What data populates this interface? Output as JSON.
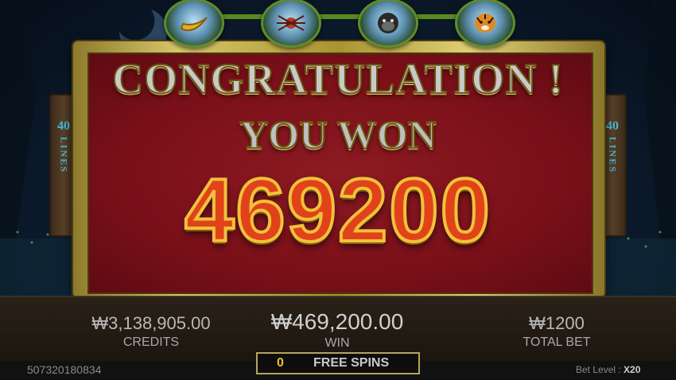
{
  "sidebars": {
    "left": {
      "number": "40",
      "label": "LINES"
    },
    "right": {
      "number": "40",
      "label": "LINES"
    }
  },
  "top_icons": [
    {
      "name": "banana-icon"
    },
    {
      "name": "spider-icon"
    },
    {
      "name": "gorilla-icon"
    },
    {
      "name": "tiger-icon"
    }
  ],
  "popup": {
    "title": "CONGRATULATION !",
    "subtitle": "YOU WON",
    "amount": "469200"
  },
  "stats": {
    "credits": {
      "value": "₩3,138,905.00",
      "label": "CREDITS"
    },
    "win": {
      "value": "₩469,200.00",
      "label": "WIN"
    },
    "total_bet": {
      "value": "₩1200",
      "label": "TOTAL BET"
    }
  },
  "status": {
    "serial": "507320180834",
    "free_spins_count": "0",
    "free_spins_label": "FREE SPINS",
    "bet_level_label": "Bet Level :",
    "bet_level_value": "X20"
  },
  "colors": {
    "panel_red": "#7a1019",
    "gold": "#d9c66a",
    "win_orange": "#e2421a",
    "side_text": "#46b8d8"
  }
}
